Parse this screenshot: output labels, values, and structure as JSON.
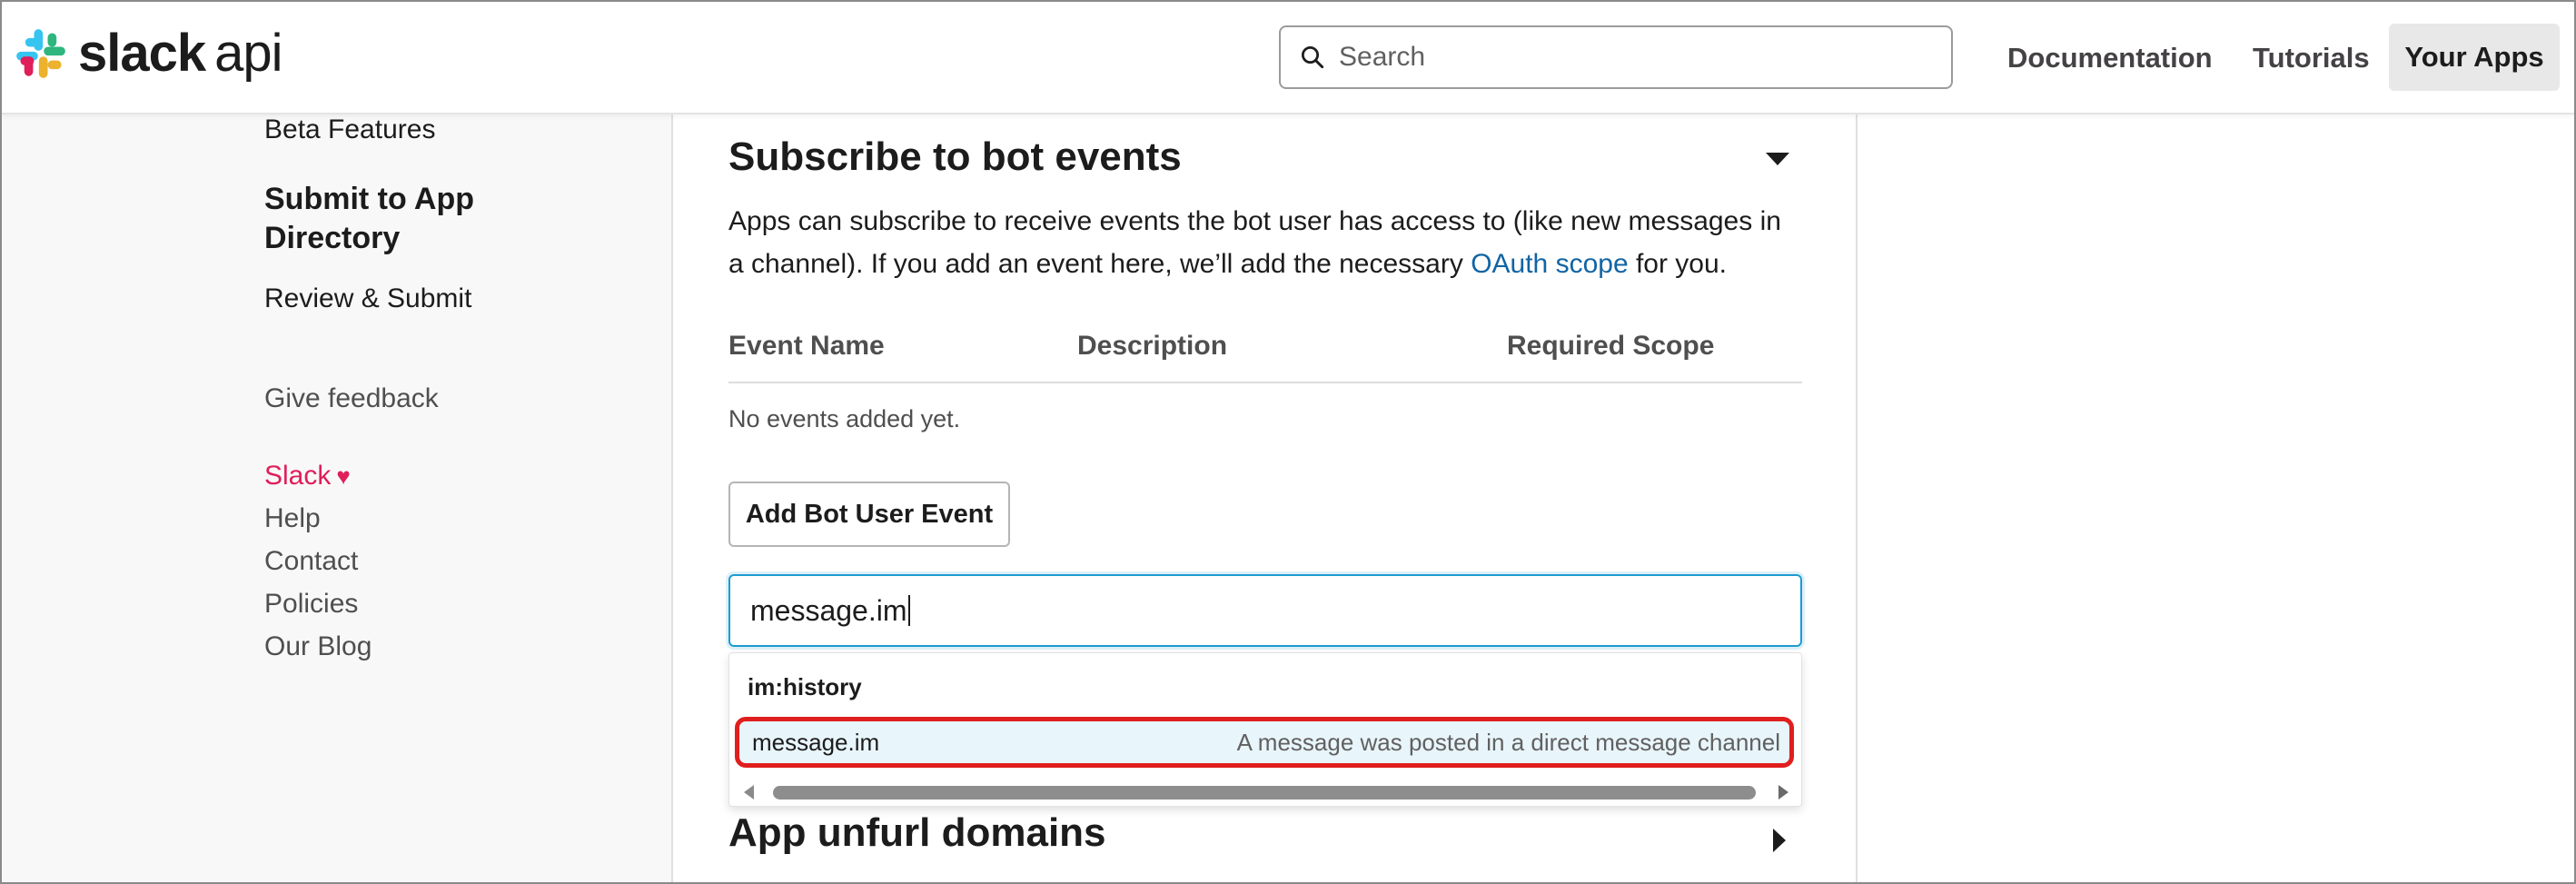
{
  "header": {
    "brand_bold": "slack",
    "brand_light": "api",
    "search_placeholder": "Search",
    "nav": {
      "documentation": "Documentation",
      "tutorials": "Tutorials",
      "your_apps": "Your Apps"
    }
  },
  "sidebar": {
    "beta_features": "Beta Features",
    "submit_line1": "Submit to App",
    "submit_line2": "Directory",
    "review_submit": "Review & Submit",
    "give_feedback": "Give feedback",
    "footer_links": {
      "slack": "Slack",
      "help": "Help",
      "contact": "Contact",
      "policies": "Policies",
      "blog": "Our Blog"
    }
  },
  "bot_events": {
    "title": "Subscribe to bot events",
    "desc_part1": "Apps can subscribe to receive events the bot user has access to (like new messages in a channel). If you add an event here, we’ll add the necessary ",
    "desc_link": "OAuth scope",
    "desc_part2": " for you.",
    "table_headers": {
      "event_name": "Event Name",
      "description": "Description",
      "required_scope": "Required Scope"
    },
    "empty_text": "No events added yet.",
    "add_button": "Add Bot User Event",
    "input_value": "message.im",
    "dropdown": {
      "group": "im:history",
      "option_name": "message.im",
      "option_desc": "A message was posted in a direct message channel"
    }
  },
  "unfurl": {
    "title": "App unfurl domains"
  },
  "colors": {
    "accent_link": "#1264a3",
    "slack_pink": "#e01e5a",
    "highlight_border": "#e01e1e",
    "focus_blue": "#1d9bd1"
  }
}
